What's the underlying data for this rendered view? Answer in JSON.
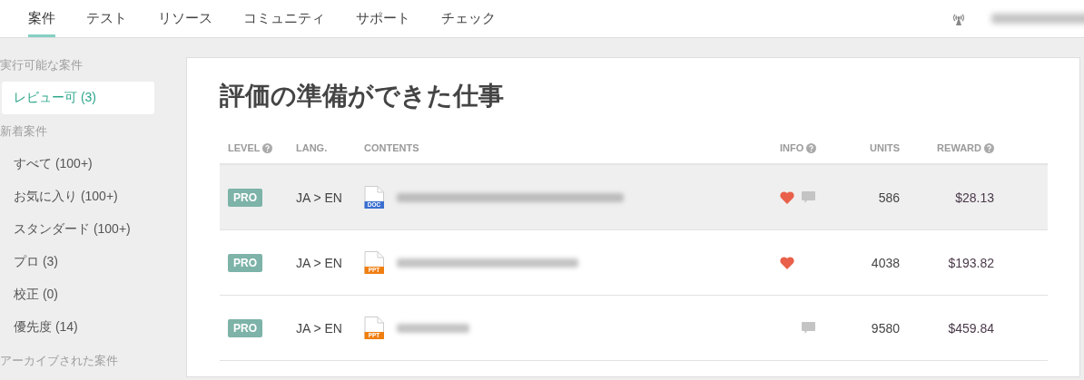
{
  "nav": {
    "tabs": [
      {
        "label": "案件",
        "selected": true
      },
      {
        "label": "テスト",
        "selected": false
      },
      {
        "label": "リソース",
        "selected": false
      },
      {
        "label": "コミュニティ",
        "selected": false
      },
      {
        "label": "サポート",
        "selected": false
      },
      {
        "label": "チェック",
        "selected": false
      }
    ]
  },
  "sidebar": {
    "sections": [
      {
        "heading": "実行可能な案件",
        "items": [
          {
            "label": "レビュー可 (3)",
            "selected": true
          }
        ]
      },
      {
        "heading": "新着案件",
        "items": [
          {
            "label": "すべて (100+)",
            "selected": false
          },
          {
            "label": "お気に入り (100+)",
            "selected": false
          },
          {
            "label": "スタンダード (100+)",
            "selected": false
          },
          {
            "label": "プロ (3)",
            "selected": false
          },
          {
            "label": "校正 (0)",
            "selected": false
          },
          {
            "label": "優先度 (14)",
            "selected": false
          }
        ]
      },
      {
        "heading": "アーカイブされた案件"
      }
    ]
  },
  "main": {
    "title": "評価の準備ができた仕事",
    "columns": [
      {
        "label": "LEVEL",
        "help": true
      },
      {
        "label": "LANG.",
        "help": false
      },
      {
        "label": "CONTENTS",
        "help": false
      },
      {
        "label": "INFO",
        "help": true
      },
      {
        "label": "UNITS",
        "help": false
      },
      {
        "label": "REWARD",
        "help": true
      }
    ],
    "rows": [
      {
        "highlighted": true,
        "level": "PRO",
        "lang": "JA > EN",
        "file_type": "DOC",
        "kind": "doc",
        "favorite": true,
        "comment": true,
        "units": "586",
        "reward": "$28.13"
      },
      {
        "highlighted": false,
        "level": "PRO",
        "lang": "JA > EN",
        "file_type": "PPT",
        "kind": "ppt",
        "favorite": true,
        "comment": false,
        "units": "4038",
        "reward": "$193.82"
      },
      {
        "highlighted": false,
        "level": "PRO",
        "lang": "JA > EN",
        "file_type": "PPT",
        "kind": "ppt",
        "favorite": false,
        "comment": true,
        "units": "9580",
        "reward": "$459.84"
      }
    ]
  }
}
